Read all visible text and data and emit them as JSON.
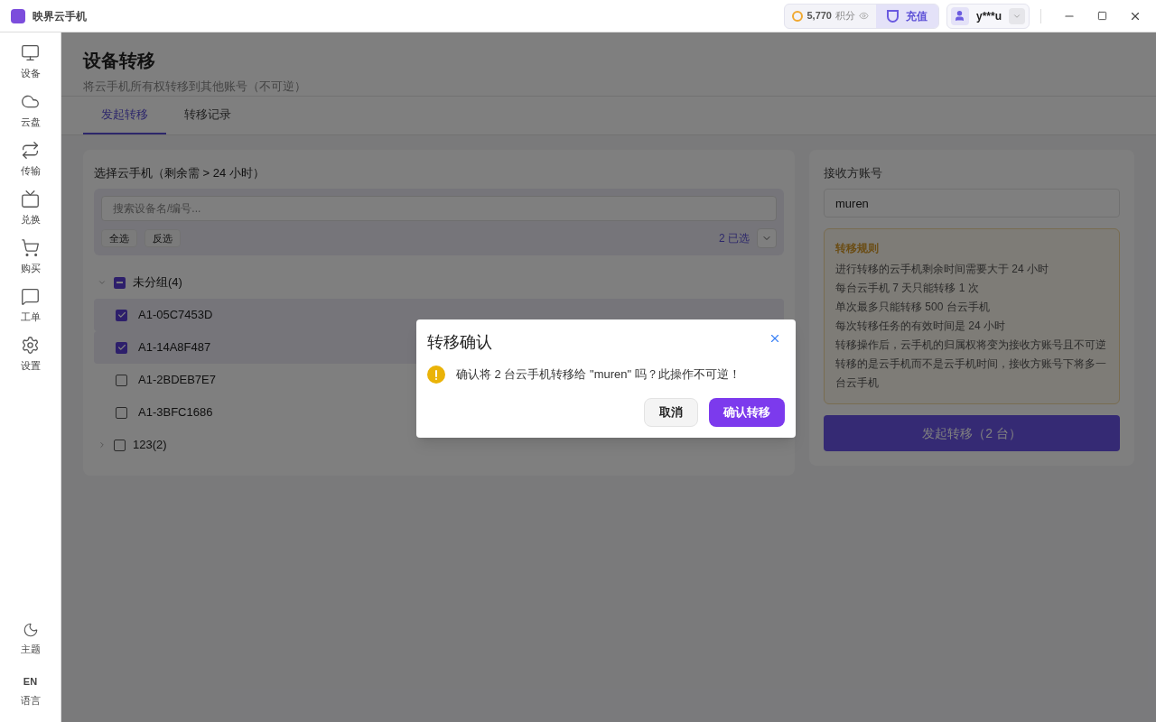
{
  "titlebar": {
    "app_name": "映界云手机",
    "points": "5,770",
    "points_unit": "积分",
    "recharge": "充值",
    "user": "y***u"
  },
  "sidebar": {
    "items": [
      {
        "label": "设备"
      },
      {
        "label": "云盘"
      },
      {
        "label": "传输"
      },
      {
        "label": "兑换"
      },
      {
        "label": "购买"
      },
      {
        "label": "工单"
      },
      {
        "label": "设置"
      }
    ],
    "theme": "主题",
    "language_code": "EN",
    "language": "语言"
  },
  "page": {
    "title": "设备转移",
    "subtitle": "将云手机所有权转移到其他账号（不可逆）"
  },
  "tabs": [
    {
      "label": "发起转移",
      "selected": true
    },
    {
      "label": "转移记录",
      "selected": false
    }
  ],
  "device_panel": {
    "title": "选择云手机（剩余需 > 24 小时）",
    "search_placeholder": "搜索设备名/编号...",
    "select_all": "全选",
    "invert": "反选",
    "selected_count": "2 已选",
    "groups": [
      {
        "name": "未分组(4)",
        "expanded": true,
        "partial": true,
        "devices": [
          {
            "id": "A1-05C7453D",
            "checked": true
          },
          {
            "id": "A1-14A8F487",
            "checked": true
          },
          {
            "id": "A1-2BDEB7E7",
            "checked": false
          },
          {
            "id": "A1-3BFC1686",
            "checked": false
          }
        ]
      },
      {
        "name": "123(2)",
        "expanded": false,
        "partial": false
      }
    ]
  },
  "receiver_panel": {
    "label": "接收方账号",
    "value": "muren",
    "rules_title": "转移规则",
    "rules": [
      "进行转移的云手机剩余时间需要大于 24 小时",
      "每台云手机 7 天只能转移 1 次",
      "单次最多只能转移 500 台云手机",
      "每次转移任务的有效时间是 24 小时",
      "转移操作后，云手机的归属权将变为接收方账号且不可逆",
      "转移的是云手机而不是云手机时间，接收方账号下将多一台云手机"
    ],
    "submit": "发起转移（2 台）"
  },
  "dialog": {
    "title": "转移确认",
    "message": "确认将 2 台云手机转移给 \"muren\" 吗？此操作不可逆！",
    "cancel": "取消",
    "confirm": "确认转移"
  }
}
